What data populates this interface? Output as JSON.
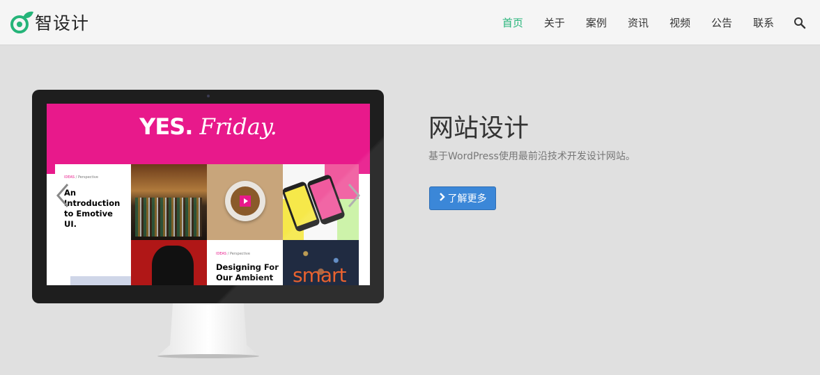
{
  "brand": {
    "name": "智设计",
    "accent": "#25b479"
  },
  "nav": {
    "items": [
      {
        "label": "首页",
        "active": true
      },
      {
        "label": "关于",
        "active": false
      },
      {
        "label": "案例",
        "active": false
      },
      {
        "label": "资讯",
        "active": false
      },
      {
        "label": "视频",
        "active": false
      },
      {
        "label": "公告",
        "active": false
      },
      {
        "label": "联系",
        "active": false
      }
    ],
    "search_icon": "search-icon"
  },
  "hero": {
    "title": "网站设计",
    "subtitle": "基于WordPress使用最前沿技术开发设计网站。",
    "button_label": "了解更多",
    "button_icon": "chevron-right-icon",
    "button_color": "#3b87d8"
  },
  "mockup": {
    "banner_yes": "YES.",
    "banner_friday": "Friday.",
    "banner_color": "#e8198b",
    "card1": {
      "tag_cat": "IDEAS",
      "tag_rest": " / Perspective",
      "title": "An Introduction to Emotive UI."
    },
    "card2": {
      "tag_cat": "IDEAS",
      "tag_rest": " / Perspective",
      "title": "Designing For Our Ambient"
    },
    "smart_text": "smart"
  }
}
